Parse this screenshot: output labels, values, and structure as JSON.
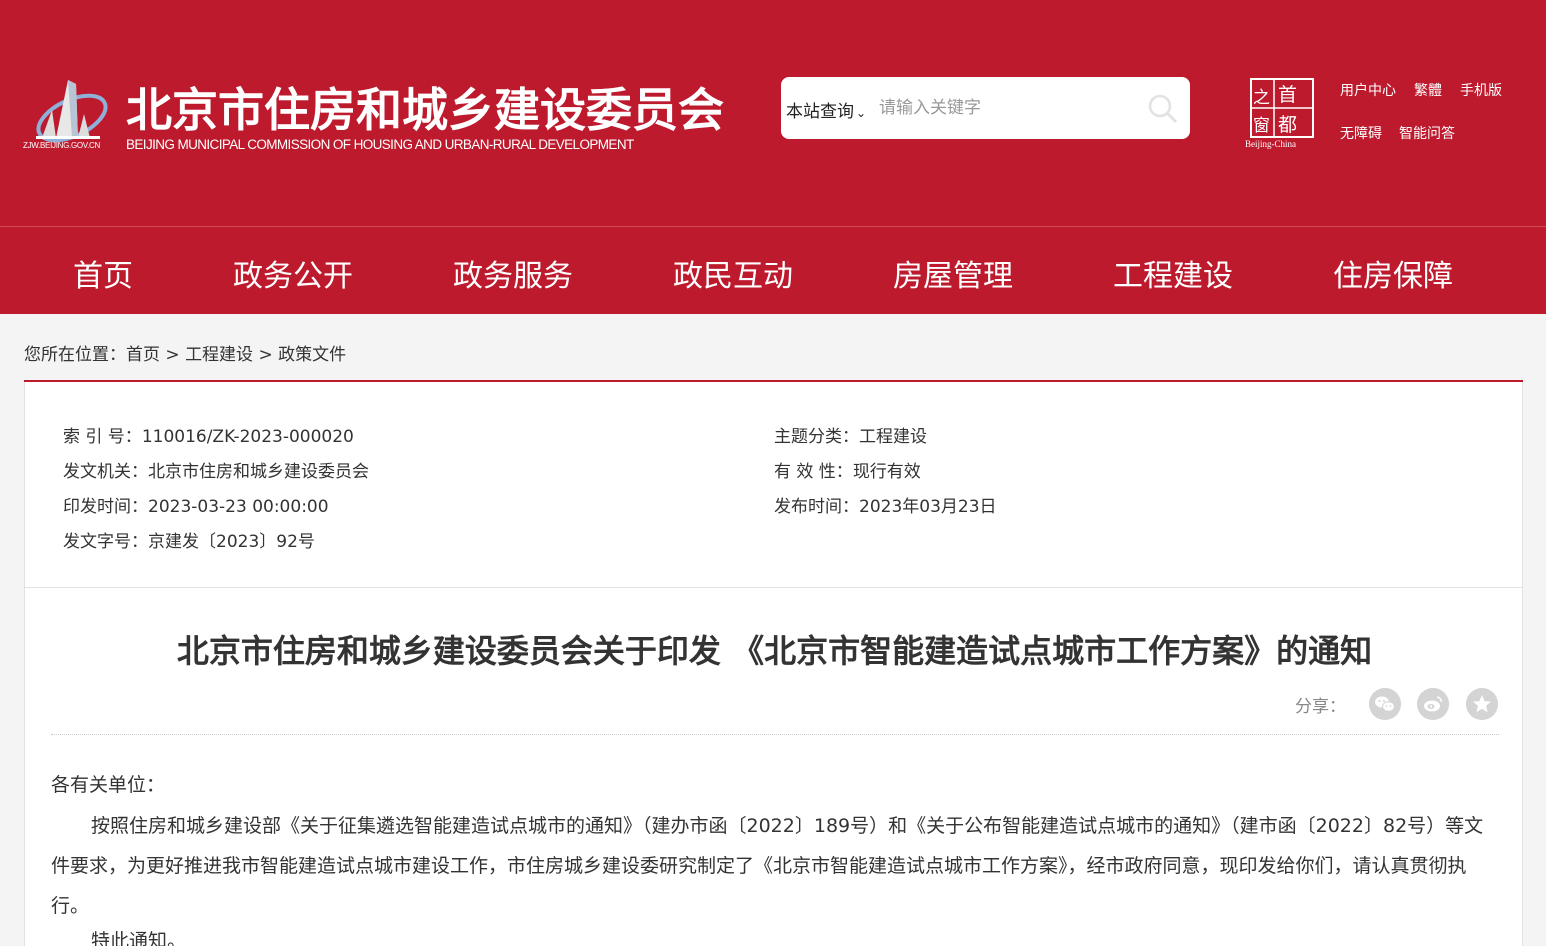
{
  "header": {
    "site_title": "北京市住房和城乡建设委员会",
    "site_subtitle": "BEIJING MUNICIPAL COMMISSION OF HOUSING AND URBAN-RURAL DEVELOPMENT",
    "logo_url_text": "ZJW.BEIJING.GOV.CN",
    "capital_logo_chars": [
      "首",
      "都",
      "之",
      "窗"
    ],
    "capital_logo_en": "Beijing-China",
    "brand_color": "#bd1a2d"
  },
  "search": {
    "scope_label": "本站查询",
    "placeholder": "请输入关键字",
    "scope_icon": "chevron-down-icon",
    "button_icon": "search-icon"
  },
  "toplinks": {
    "user_center": "用户中心",
    "traditional": "繁體",
    "mobile": "手机版",
    "accessibility": "无障碍",
    "qa": "智能问答"
  },
  "nav": {
    "items": [
      "首页",
      "政务公开",
      "政务服务",
      "政民互动",
      "房屋管理",
      "工程建设",
      "住房保障"
    ]
  },
  "breadcrumb": {
    "prefix": "您所在位置：",
    "home": "首页",
    "sep": ">",
    "section": "工程建设",
    "current": "政策文件"
  },
  "meta": {
    "index_label": "索 引 号：",
    "index_value": "110016/ZK-2023-000020",
    "issuer_label": "发文机关：",
    "issuer_value": "北京市住房和城乡建设委员会",
    "print_time_label": "印发时间：",
    "print_time_value": "2023-03-23 00:00:00",
    "doc_no_label": "发文字号：",
    "doc_no_value": "京建发〔2023〕92号",
    "topic_label": "主题分类：",
    "topic_value": "工程建设",
    "validity_label": "有 效 性：",
    "validity_value": "现行有效",
    "publish_time_label": "发布时间：",
    "publish_time_value": "2023年03月23日"
  },
  "article": {
    "title": "北京市住房和城乡建设委员会关于印发 《北京市智能建造试点城市工作方案》的通知",
    "share_label": "分享：",
    "share_icons": [
      "wechat-icon",
      "weibo-icon",
      "favorite-icon"
    ],
    "salutation": "各有关单位：",
    "body": "按照住房和城乡建设部《关于征集遴选智能建造试点城市的通知》（建办市函〔2022〕189号）和《关于公布智能建造试点城市的通知》（建市函〔2022〕82号）等文件要求，为更好推进我市智能建造试点城市建设工作，市住房城乡建设委研究制定了《北京市智能建造试点城市工作方案》，经市政府同意，现印发给你们，请认真贯彻执行。",
    "closing": "特此通知。"
  }
}
